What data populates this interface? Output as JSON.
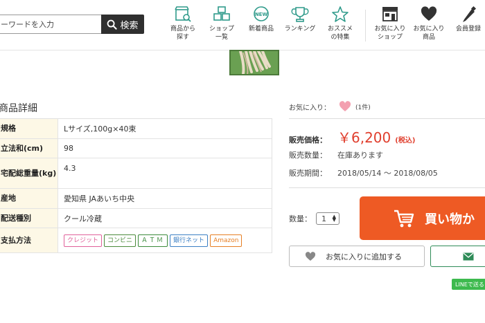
{
  "header": {
    "search": {
      "placeholder": "ーワードを入力",
      "button_label": "検索"
    },
    "nav": [
      {
        "line1": "商品から",
        "line2": "探す",
        "icon": "store-search-icon"
      },
      {
        "line1": "ショップ",
        "line2": "一覧",
        "icon": "shop-list-icon"
      },
      {
        "line1": "新着商品",
        "line2": "",
        "icon": "new-badge-icon"
      },
      {
        "line1": "ランキング",
        "line2": "",
        "icon": "trophy-icon"
      },
      {
        "line1": "おススメ",
        "line2": "の特集",
        "icon": "star-icon"
      },
      {
        "line1": "お気に入り",
        "line2": "ショップ",
        "icon": "shop-icon"
      },
      {
        "line1": "お気に入り",
        "line2": "商品",
        "icon": "heart-icon"
      },
      {
        "line1": "会員登録",
        "line2": "",
        "icon": "pencil-icon"
      }
    ]
  },
  "details": {
    "title": "商品詳細",
    "rows": [
      {
        "label": "規格",
        "value": "Lサイズ,100g×40束"
      },
      {
        "label": "立法和(cm)",
        "value": "98"
      },
      {
        "label": "宅配総重量(kg)",
        "value": "4.3"
      },
      {
        "label": "産地",
        "value": "愛知県 JAあいち中央"
      },
      {
        "label": "配送種別",
        "value": "クール冷蔵"
      },
      {
        "label": "支払方法",
        "value": ""
      }
    ],
    "payment_badges": [
      {
        "label": "クレジット",
        "color": "#e0609a"
      },
      {
        "label": "コンビニ",
        "color": "#4a8a3a"
      },
      {
        "label": "ＡＴＭ",
        "color": "#3a8a3a"
      },
      {
        "label": "銀行ネット",
        "color": "#3b7fc4"
      },
      {
        "label": "Amazon",
        "color": "#e67e22"
      }
    ]
  },
  "product": {
    "favorite_label": "お気に入り：",
    "favorite_count": "(1件)",
    "price_label": "販売価格：",
    "price": "￥6,200",
    "tax_note": "(税込)",
    "stock_label": "販売数量：",
    "stock_value": "在庫あります",
    "period_label": "販売期間：",
    "period_value": "2018/05/14 〜 2018/08/05",
    "qty_label": "数量：",
    "qty_value": "1",
    "cart_button": "買い物か",
    "add_favorite_button": "お気に入りに追加する",
    "line_badge": "LINEで送る",
    "colors": {
      "accent": "#ee5a24",
      "price": "#e03e2d",
      "heart": "#f3a0b0",
      "line": "#3dba4e"
    }
  }
}
